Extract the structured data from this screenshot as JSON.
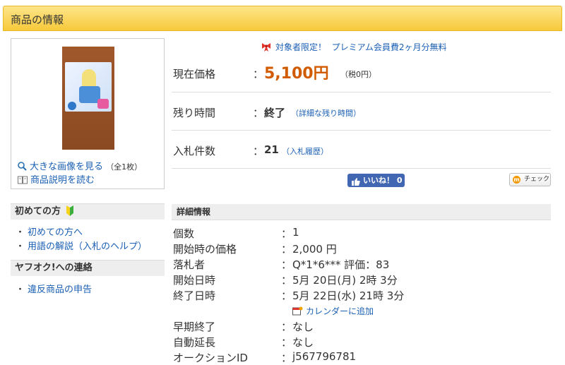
{
  "header": {
    "title": "商品の情報"
  },
  "thumbnail": {
    "view_larger": "大きな画像を見る",
    "count_note": "（全1枚）",
    "read_description": "商品説明を読む"
  },
  "promo": {
    "prefix": "対象者限定！",
    "text": "プレミアム会員費2ヶ月分無料"
  },
  "summary": {
    "price_label": "現在価格",
    "colon": "：",
    "price_value": "5,100円",
    "price_tax": "（税0円）",
    "time_label": "残り時間",
    "time_value": "終了",
    "time_detail": "（詳細な残り時間）",
    "bids_label": "入札件数",
    "bids_value": "21",
    "bids_history": "（入札履歴）"
  },
  "social": {
    "like_label": "いいね！ 0",
    "check_label": "チェック",
    "check_icon": "m"
  },
  "sidebar": {
    "beginners_head": "初めての方",
    "beginners_items": [
      "初めての方へ",
      "用語の解説（入札のヘルプ）"
    ],
    "contact_head": "ヤフオク!への連絡",
    "contact_items": [
      "違反商品の申告"
    ],
    "bullet": "・"
  },
  "details": {
    "head": "詳細情報",
    "colon": "：",
    "rows": [
      {
        "label": "個数",
        "value": "1"
      },
      {
        "label": "開始時の価格",
        "value": "2,000 円"
      },
      {
        "label": "落札者",
        "value": "Q*1*6*** 評価：83"
      },
      {
        "label": "開始日時",
        "value": "5月 20日(月) 2時 3分"
      },
      {
        "label": "終了日時",
        "value": "5月 22日(水) 21時 3分"
      }
    ],
    "calendar_link": "カレンダーに追加",
    "rows2": [
      {
        "label": "早期終了",
        "value": "なし"
      },
      {
        "label": "自動延長",
        "value": "なし"
      },
      {
        "label": "オークションID",
        "value": "j567796781"
      }
    ]
  },
  "colors": {
    "accent_price": "#d15b00",
    "link": "#1a5fb4",
    "header_bg": "#f7c93a",
    "like_bg": "#4267b2"
  }
}
